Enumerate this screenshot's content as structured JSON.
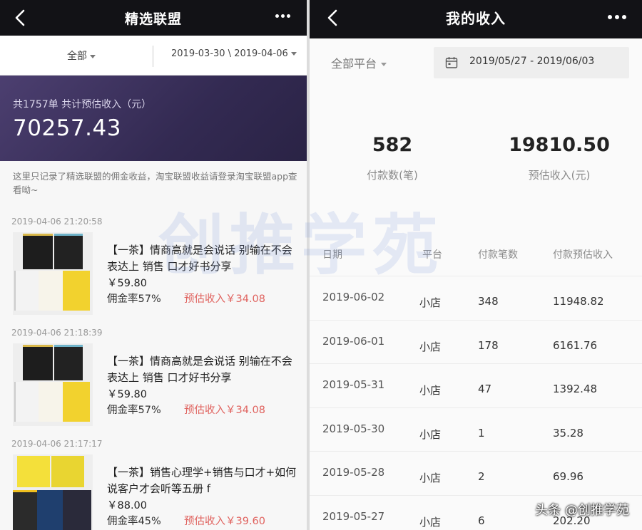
{
  "left": {
    "nav": {
      "title": "精选联盟",
      "back_icon": "chevron-left-icon",
      "more_icon": "ellipsis-icon"
    },
    "filter": {
      "category": "全部",
      "date_range": "2019-03-30 \\ 2019-04-06"
    },
    "summary": {
      "label": "共1757单 共计预估收入（元）",
      "total": "70257.43"
    },
    "note": "这里只记录了精选联盟的佣金收益，淘宝联盟收益请登录淘宝联盟app查看呦~",
    "orders": [
      {
        "time": "2019-04-06 21:20:58",
        "title": "【一茶】情商高就是会说话 别输在不会表达上 销售 口才好书分享",
        "price": "￥59.80",
        "rate": "佣金率57%",
        "estimate": "预估收入￥34.08"
      },
      {
        "time": "2019-04-06 21:18:39",
        "title": "【一茶】情商高就是会说话 别输在不会表达上 销售 口才好书分享",
        "price": "￥59.80",
        "rate": "佣金率57%",
        "estimate": "预估收入￥34.08"
      },
      {
        "time": "2019-04-06 21:17:17",
        "title": "【一茶】销售心理学+销售与口才+如何说客户才会听等五册 f",
        "price": "￥88.00",
        "rate": "佣金率45%",
        "estimate": "预估收入￥39.60"
      }
    ]
  },
  "right": {
    "nav": {
      "title": "我的收入",
      "back_icon": "chevron-left-icon",
      "more_icon": "ellipsis-icon"
    },
    "filter": {
      "platform": "全部平台",
      "date_range": "2019/05/27 - 2019/06/03",
      "calendar_icon": "calendar-icon"
    },
    "stats": [
      {
        "value": "582",
        "label": "付款数(笔)"
      },
      {
        "value": "19810.50",
        "label": "预估收入(元)"
      }
    ],
    "table": {
      "headers": [
        "日期",
        "平台",
        "付款笔数",
        "付款预估收入"
      ],
      "rows": [
        [
          "2019-06-02",
          "小店",
          "348",
          "11948.82"
        ],
        [
          "2019-06-01",
          "小店",
          "178",
          "6161.76"
        ],
        [
          "2019-05-31",
          "小店",
          "47",
          "1392.48"
        ],
        [
          "2019-05-30",
          "小店",
          "1",
          "35.28"
        ],
        [
          "2019-05-28",
          "小店",
          "2",
          "69.96"
        ],
        [
          "2019-05-27",
          "小店",
          "6",
          "202.20"
        ]
      ]
    }
  },
  "watermark": "创推学苑",
  "credit": "头条 @创推学苑",
  "colors": {
    "nav_bg": "#121216",
    "summary_bg": "#3d3260",
    "estimate_red": "#e0635f"
  }
}
